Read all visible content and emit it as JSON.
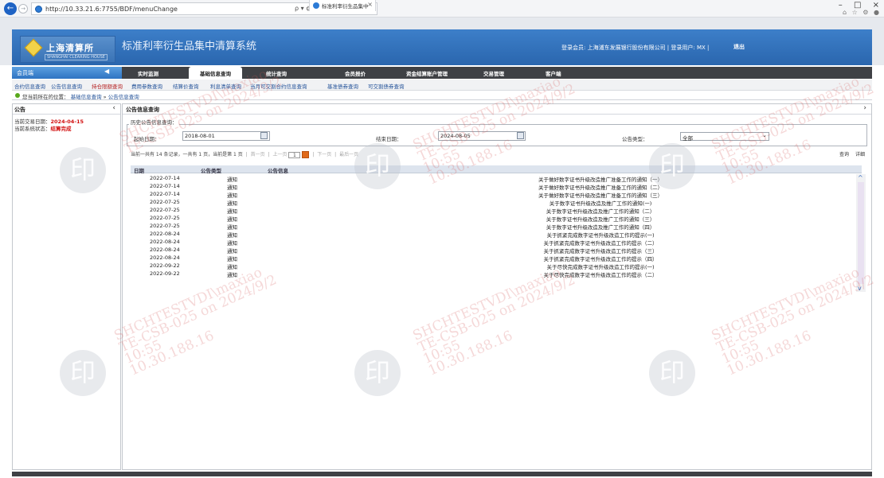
{
  "browser": {
    "back": "←",
    "forward": "→",
    "url": "http://10.33.21.6:7755/BDF/menuChange",
    "address_tools": "ρ ▾ ¢",
    "tab_title": "标准利率衍生品集中清算系...",
    "tab_close": "×",
    "min": "–",
    "max": "□",
    "close": "×",
    "icons": "⌂ ☆ ⚙ ●"
  },
  "header": {
    "brand_cn": "上海清算所",
    "brand_en": "SHANGHAI CLEARING HOUSE",
    "system_title": "标准利率衍生品集中清算系统",
    "login_info": "登录会员: 上海浦东发展银行股份有限公司  |  登录用户: MX  |",
    "logout": "退出"
  },
  "nav": {
    "member_tab": "会员端",
    "collapse": "◀",
    "tabs": [
      "实时监测",
      "基础信息查询",
      "统计查询",
      "会员报价",
      "资金结算账户管理",
      "交易管理",
      "客户端"
    ]
  },
  "subnav": {
    "items": [
      "合约信息查询",
      "公告信息查询",
      "持仓限额查询",
      "费用参数查询",
      "结算价查询",
      "利息清单查询",
      "当月可交割合约信息查询",
      "基准债券查询",
      "可交割债券查询"
    ]
  },
  "breadcrumb": {
    "prefix": "您当前所在的位置：",
    "level1": "基础信息查询",
    "sep": "»",
    "level2": "公告信息查询"
  },
  "left_panel": {
    "title": "公告",
    "collapse": "‹",
    "trade_date_label": "当前交易日期：",
    "trade_date": "2024-04-15",
    "status_label": "当前系统状态：",
    "status": "结算完成"
  },
  "right_panel": {
    "title": "公告信息查询",
    "expand": "›",
    "legend": "历史公告信息查询：",
    "start_label": "起始日期：",
    "start_value": "2018-08-01",
    "end_label": "结束日期：",
    "end_value": "2024-08-05",
    "type_label": "公告类型：",
    "type_value": "全部",
    "select_arrow": "⌄",
    "pager": {
      "text": "当前一共有  14  条记录，一共有  1  页，当前是第  1  页",
      "first": "首一页",
      "prev": "上一页",
      "page_input": "1",
      "next": "下一页",
      "last": "最后一页"
    },
    "search_btn": "查询",
    "detail_btn": "详细",
    "columns": [
      "日期",
      "公告类型",
      "公告信息"
    ],
    "rows": [
      {
        "date": "2022-07-14",
        "type": "通知",
        "info": "关于做好数字证书升级改造推广准备工作的通知（一）"
      },
      {
        "date": "2022-07-14",
        "type": "通知",
        "info": "关于做好数字证书升级改造推广准备工作的通知（二）"
      },
      {
        "date": "2022-07-14",
        "type": "通知",
        "info": "关于做好数字证书升级改造推广准备工作的通知（三）"
      },
      {
        "date": "2022-07-25",
        "type": "通知",
        "info": "关于数字证书升级改造及推广工作的通知(一)"
      },
      {
        "date": "2022-07-25",
        "type": "通知",
        "info": "关于数字证书升级改造及推广工作的通知（二）"
      },
      {
        "date": "2022-07-25",
        "type": "通知",
        "info": "关于数字证书升级改造及推广工作的通知（三）"
      },
      {
        "date": "2022-07-25",
        "type": "通知",
        "info": "关于数字证书升级改造及推广工作的通知（四）"
      },
      {
        "date": "2022-08-24",
        "type": "通知",
        "info": "关于抓紧完成数字证书升级改造工作的提示(一)"
      },
      {
        "date": "2022-08-24",
        "type": "通知",
        "info": "关于抓紧完成数字证书升级改造工作的提示（二）"
      },
      {
        "date": "2022-08-24",
        "type": "通知",
        "info": "关于抓紧完成数字证书升级改造工作的提示（三）"
      },
      {
        "date": "2022-08-24",
        "type": "通知",
        "info": "关于抓紧完成数字证书升级改造工作的提示（四）"
      },
      {
        "date": "2022-09-22",
        "type": "通知",
        "info": "关于尽快完成数字证书升级改造工作的提示(一)"
      },
      {
        "date": "2022-09-22",
        "type": "通知",
        "info": "关于尽快完成数字证书升级改造工作的提示（二）"
      }
    ]
  },
  "watermark": {
    "line1": "SHCHTESTVDI\\maxiao",
    "line2": "TE-CSB-025 on 2024/9/2",
    "line3": "10:55",
    "line4": "10.30.188.16",
    "stamp": "印"
  },
  "colors": {
    "header_blue": "#2a66ae",
    "nav_dark": "#3f4145",
    "status_red": "#d21010",
    "link_blue": "#1f4f97"
  }
}
